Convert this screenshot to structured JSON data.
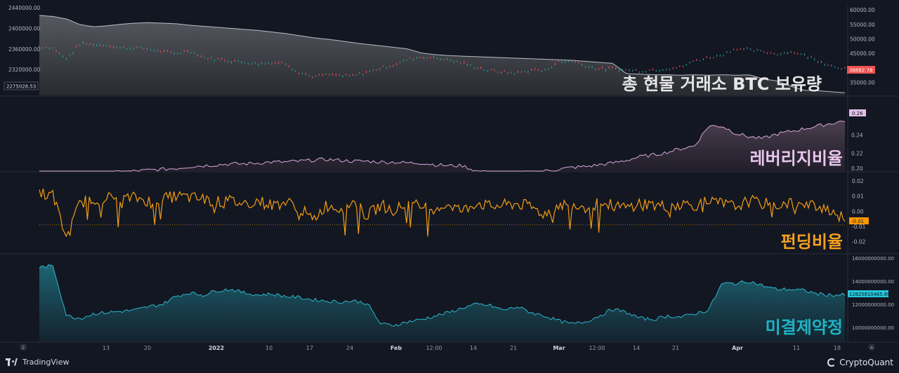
{
  "chart_data": [
    {
      "type": "area",
      "panel": "exchange-reserve",
      "title": "총 현물 거래소 BTC 보유량",
      "left_axis": {
        "ticks": [
          "2440000.00",
          "2400000.00",
          "2360000.00",
          "2320000.00"
        ],
        "ylim": [
          2270000,
          2444000
        ]
      },
      "right_axis": {
        "ticks": [
          "60000.00",
          "55000.00",
          "50000.00",
          "45000.00",
          "40000.00",
          "35000.00"
        ],
        "ylim": [
          30500,
          61500
        ]
      },
      "left_last_label": "2275028.53",
      "right_last_label": "38882.78",
      "series": [
        {
          "name": "",
          "axis": "left",
          "values": [
            2425000,
            2423000,
            2418000,
            2407000,
            2403000,
            2405000,
            2408000,
            2410000,
            2411000,
            2410000,
            2409000,
            2406000,
            2404000,
            2402000,
            2400000,
            2398000,
            2396000,
            2393000,
            2390000,
            2386000,
            2382000,
            2379000,
            2376000,
            2372000,
            2369000,
            2366000,
            2363000,
            2360000,
            2352000,
            2349000,
            2347000,
            2346000,
            2345000,
            2344000,
            2343000,
            2342000,
            2341000,
            2340000,
            2339000,
            2338000,
            2336000,
            2334000,
            2332000,
            2312000,
            2311000,
            2310000,
            2310000,
            2309000,
            2310000,
            2309000,
            2310000,
            2309000,
            2310000,
            2302000,
            2298000,
            2288000,
            2280000,
            2279000,
            2277000,
            2275000
          ]
        },
        {
          "name": "",
          "axis": "right",
          "values": [
            47500,
            46800,
            43000,
            48500,
            48000,
            47800,
            46800,
            47000,
            46500,
            45500,
            45000,
            46000,
            43500,
            43000,
            42500,
            42000,
            41500,
            41800,
            41600,
            38500,
            37000,
            37500,
            37300,
            37200,
            38500,
            40000,
            41000,
            43000,
            43800,
            43500,
            42800,
            41500,
            40200,
            39000,
            38500,
            38200,
            39300,
            39000,
            42000,
            42500,
            40800,
            39500,
            39800,
            39200,
            39000,
            39300,
            39800,
            40200,
            42500,
            43500,
            44500,
            46700,
            46200,
            45500,
            44800,
            45500,
            44500,
            42600,
            40800,
            39700
          ]
        }
      ]
    },
    {
      "type": "area",
      "panel": "leverage-ratio",
      "title": "레버리지비율",
      "ticks": [
        "0.24",
        "0.22",
        "0.20"
      ],
      "ylim": [
        0.2,
        0.27
      ],
      "last_label": "0.26",
      "series": [
        {
          "name": "",
          "values": [
            0.196,
            0.195,
            0.196,
            0.197,
            0.198,
            0.198,
            0.199,
            0.2,
            0.201,
            0.202,
            0.203,
            0.205,
            0.206,
            0.207,
            0.208,
            0.208,
            0.209,
            0.21,
            0.21,
            0.211,
            0.212,
            0.213,
            0.212,
            0.211,
            0.211,
            0.21,
            0.21,
            0.209,
            0.209,
            0.207,
            0.206,
            0.206,
            0.2,
            0.198,
            0.197,
            0.197,
            0.199,
            0.2,
            0.202,
            0.204,
            0.205,
            0.207,
            0.209,
            0.212,
            0.216,
            0.218,
            0.221,
            0.225,
            0.228,
            0.25,
            0.25,
            0.242,
            0.238,
            0.236,
            0.241,
            0.244,
            0.247,
            0.25,
            0.253,
            0.256
          ]
        }
      ]
    },
    {
      "type": "line",
      "panel": "funding-rate",
      "title": "펀딩비율",
      "ticks": [
        "0.02",
        "0.01",
        "0.00",
        "-0.01",
        "-0.02"
      ],
      "ylim": [
        -0.0275,
        0.0255
      ],
      "last_label": "-0.01",
      "series": [
        {
          "name": "",
          "values": [
            0.013,
            0.01,
            -0.018,
            0.006,
            0.008,
            0.009,
            0.008,
            0.009,
            0.007,
            0.008,
            0.01,
            0.009,
            0.008,
            0.006,
            0.007,
            0.005,
            0.007,
            0.004,
            0.006,
            0.003,
            -0.006,
            0.004,
            0.002,
            0.006,
            -0.003,
            0.004,
            0.001,
            0.005,
            0.003,
            0.002,
            0.005,
            0.0,
            0.006,
            0.003,
            0.004,
            0.005,
            0.003,
            -0.002,
            0.004,
            0.005,
            0.003,
            0.005,
            0.004,
            0.002,
            0.006,
            0.004,
            0.003,
            0.005,
            0.004,
            0.006,
            0.005,
            0.003,
            0.007,
            0.005,
            0.004,
            0.006,
            0.003,
            0.004,
            0.001,
            -0.006
          ]
        }
      ]
    },
    {
      "type": "area",
      "panel": "open-interest",
      "title": "미결제약정",
      "ticks": [
        "16000000000",
        "14000000000",
        "12000000000",
        "10000000000"
      ],
      "ylim": [
        8800000000,
        16300000000
      ],
      "last_label": "12825810465.89",
      "series": [
        {
          "name": "",
          "values": [
            15200000000,
            15300000000,
            11000000000,
            10800000000,
            11200000000,
            11300000000,
            11400000000,
            11500000000,
            11800000000,
            12000000000,
            12700000000,
            13000000000,
            12800000000,
            13200000000,
            13300000000,
            13000000000,
            12800000000,
            12900000000,
            12700000000,
            12600000000,
            12400000000,
            12300000000,
            12200000000,
            12300000000,
            12100000000,
            10300000000,
            10200000000,
            10500000000,
            10700000000,
            11000000000,
            11300000000,
            11700000000,
            12000000000,
            11900000000,
            11500000000,
            11800000000,
            11300000000,
            11000000000,
            10600000000,
            10300000000,
            10500000000,
            11000000000,
            11600000000,
            11300000000,
            10800000000,
            10700000000,
            11000000000,
            10900000000,
            11200000000,
            11500000000,
            13800000000,
            13800000000,
            14000000000,
            13600000000,
            13300000000,
            13300000000,
            13200000000,
            12900000000,
            12800000000,
            12820000000
          ]
        }
      ]
    }
  ],
  "x_axis": {
    "ticks": [
      "13",
      "20",
      "2022",
      "10",
      "17",
      "24",
      "Feb",
      "12:00",
      "14",
      "21",
      "Mar",
      "12:00",
      "14",
      "21",
      "Apr",
      "11",
      "18"
    ],
    "bold_ticks": [
      "2022",
      "Feb",
      "Mar",
      "Apr"
    ]
  },
  "footer": {
    "left_brand": "TradingView",
    "right_brand": "CryptoQuant",
    "left_badge": "Z",
    "right_badge": "A"
  },
  "colors": {
    "background": "#131722",
    "reserve_line": "#b9bcc4",
    "price_up": "#26a69a",
    "price_down": "#ef5350",
    "leverage": "#d8a8d8",
    "funding": "#f39c12",
    "open_interest": "#2bb5cc",
    "price_badge": "#ef5350",
    "oi_badge": "#26c6da",
    "leverage_badge": "#e1bee7",
    "funding_badge": "#ff9800"
  }
}
